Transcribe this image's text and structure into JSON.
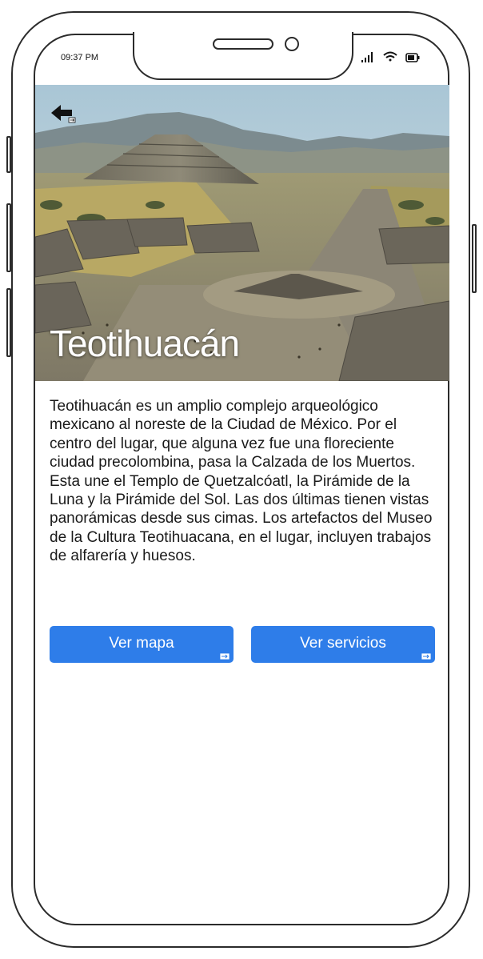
{
  "status_bar": {
    "time": "09:37 PM",
    "icons": [
      "signal-icon",
      "wifi-icon",
      "battery-icon"
    ]
  },
  "hero": {
    "title": "Teotihuacán",
    "back_icon": "back-arrow-icon"
  },
  "description": "Teotihuacán es un amplio complejo arqueológico mexicano al noreste de la Ciudad de México. Por el centro del lugar, que alguna vez fue una floreciente ciudad precolombina, pasa la Calzada de los Muertos. Esta une el Templo de Quetzalcóatl, la Pirámide de la Luna y la Pirámide del Sol. Las dos últimas tienen vistas panorámicas desde sus cimas. Los artefactos del Museo de la Cultura Teotihuacana, en el lugar, incluyen trabajos de alfarería y huesos.",
  "buttons": {
    "map_label": "Ver mapa",
    "services_label": "Ver servicios"
  },
  "colors": {
    "accent": "#2e7de9",
    "frame": "#2b2b2b"
  }
}
